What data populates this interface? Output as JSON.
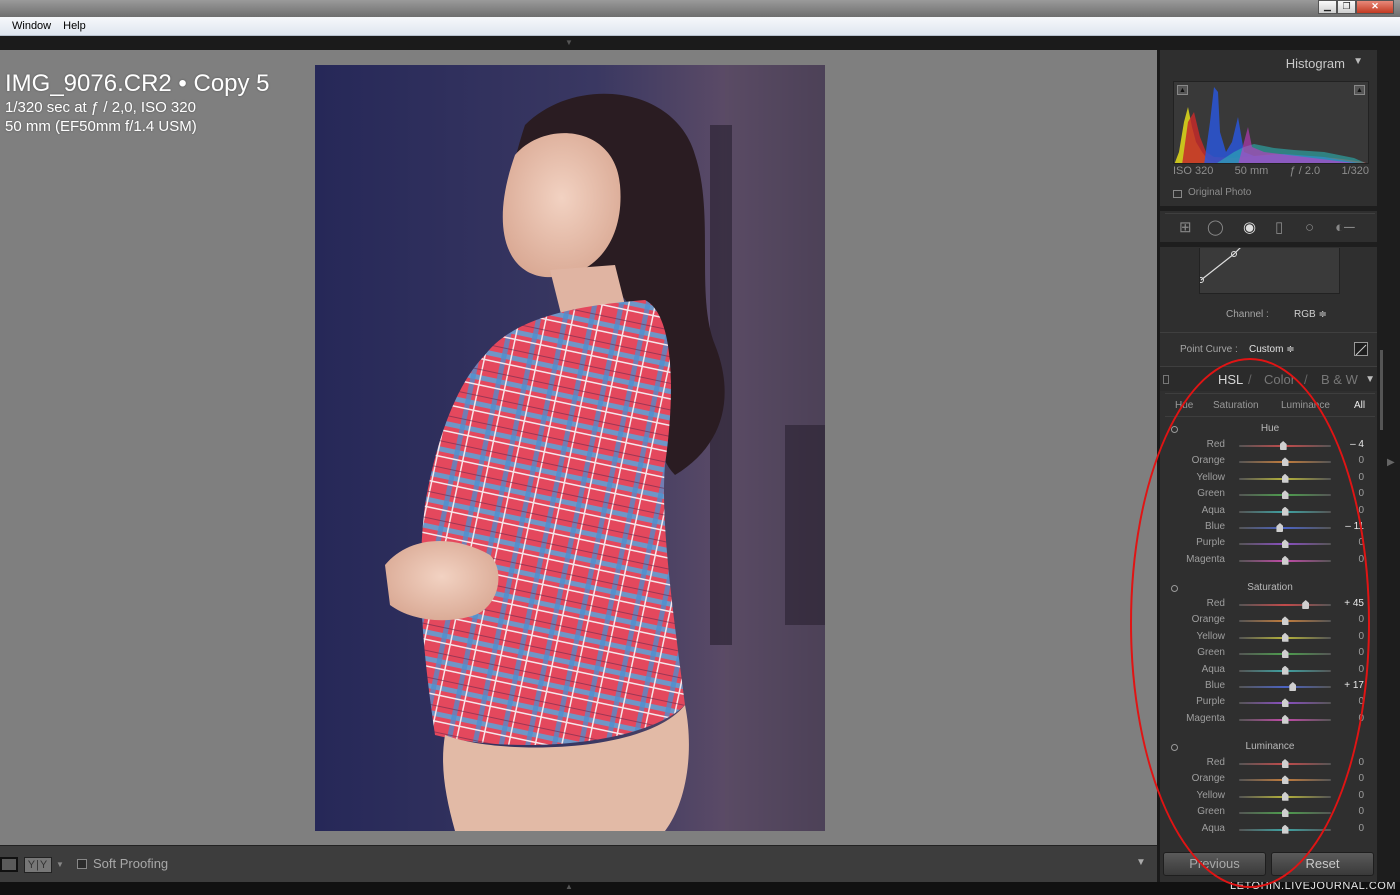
{
  "menu": [
    "Window",
    "Help"
  ],
  "window_controls": [
    "▁",
    "❐",
    "✕"
  ],
  "info": {
    "filename": "IMG_9076.CR2 • Copy 5",
    "exposure": "1/320 sec at ƒ / 2,0, ISO 320",
    "lens": "50 mm (EF50mm f/1.4 USM)"
  },
  "histogram": {
    "title": "Histogram",
    "iso": "ISO 320",
    "focal": "50 mm",
    "aperture": "ƒ / 2.0",
    "shutter": "1/320",
    "original_photo": "Original Photo"
  },
  "curve": {
    "channel_label": "Channel :",
    "channel_value": "RGB ≑",
    "point_curve_label": "Point Curve :",
    "point_curve_value": "Custom ≑"
  },
  "hsl_panel": {
    "titles": [
      "HSL",
      "/",
      "Color",
      "/",
      "B & W"
    ],
    "tabs": [
      "Hue",
      "Saturation",
      "Luminance",
      "All"
    ],
    "active_tab": "All",
    "sections": [
      {
        "title": "Hue",
        "rows": [
          {
            "label": "Red",
            "value": "– 4",
            "num": -4
          },
          {
            "label": "Orange",
            "value": "0",
            "num": 0
          },
          {
            "label": "Yellow",
            "value": "0",
            "num": 0
          },
          {
            "label": "Green",
            "value": "0",
            "num": 0
          },
          {
            "label": "Aqua",
            "value": "0",
            "num": 0
          },
          {
            "label": "Blue",
            "value": "– 11",
            "num": -11
          },
          {
            "label": "Purple",
            "value": "0",
            "num": 0
          },
          {
            "label": "Magenta",
            "value": "0",
            "num": 0
          }
        ]
      },
      {
        "title": "Saturation",
        "rows": [
          {
            "label": "Red",
            "value": "+ 45",
            "num": 45
          },
          {
            "label": "Orange",
            "value": "0",
            "num": 0
          },
          {
            "label": "Yellow",
            "value": "0",
            "num": 0
          },
          {
            "label": "Green",
            "value": "0",
            "num": 0
          },
          {
            "label": "Aqua",
            "value": "0",
            "num": 0
          },
          {
            "label": "Blue",
            "value": "+ 17",
            "num": 17
          },
          {
            "label": "Purple",
            "value": "0",
            "num": 0
          },
          {
            "label": "Magenta",
            "value": "0",
            "num": 0
          }
        ]
      },
      {
        "title": "Luminance",
        "rows": [
          {
            "label": "Red",
            "value": "0",
            "num": 0
          },
          {
            "label": "Orange",
            "value": "0",
            "num": 0
          },
          {
            "label": "Yellow",
            "value": "0",
            "num": 0
          },
          {
            "label": "Green",
            "value": "0",
            "num": 0
          },
          {
            "label": "Aqua",
            "value": "0",
            "num": 0
          }
        ]
      }
    ]
  },
  "toolbar": {
    "yy_label": "Y|Y",
    "soft_proofing": "Soft Proofing"
  },
  "buttons": {
    "previous": "Previous",
    "reset": "Reset"
  },
  "watermark": "LETOHIN.LIVEJOURNAL.COM",
  "colors": {
    "annotation": "#e01414",
    "track_colors": {
      "Red": "#c24a4a",
      "Orange": "#c27c3c",
      "Yellow": "#b5b23a",
      "Green": "#4d9e4d",
      "Aqua": "#3ea3a3",
      "Blue": "#4b63c2",
      "Purple": "#8a4fc2",
      "Magenta": "#c24aa8"
    }
  }
}
